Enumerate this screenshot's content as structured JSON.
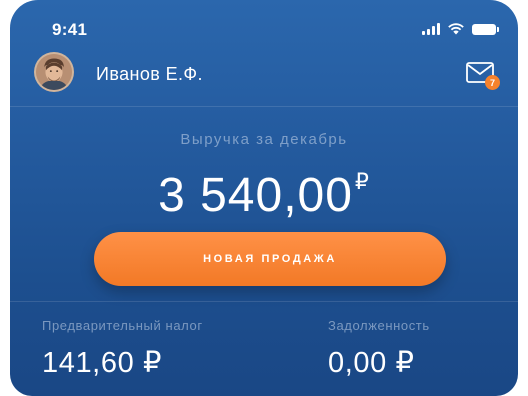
{
  "status_bar": {
    "time": "9:41",
    "icons": [
      "cellular-signal-icon",
      "wifi-icon",
      "battery-icon"
    ]
  },
  "header": {
    "user_name": "Иванов Е.Ф.",
    "avatar": "user-avatar",
    "mail_icon": "envelope-icon",
    "mail_badge_count": "7"
  },
  "revenue": {
    "label": "Выручка за декабрь",
    "amount": "3 540,00",
    "currency": "₽"
  },
  "actions": {
    "new_sale_label": "НОВАЯ ПРОДАЖА"
  },
  "stats": {
    "tax": {
      "label": "Предварительный налог",
      "value": "141,60 ₽"
    },
    "debt": {
      "label": "Задолженность",
      "value": "0,00 ₽"
    }
  },
  "colors": {
    "background_top": "#2b67ad",
    "background_bottom": "#1a4785",
    "accent": "#f7822c",
    "muted_text": "#c8d7eb"
  }
}
